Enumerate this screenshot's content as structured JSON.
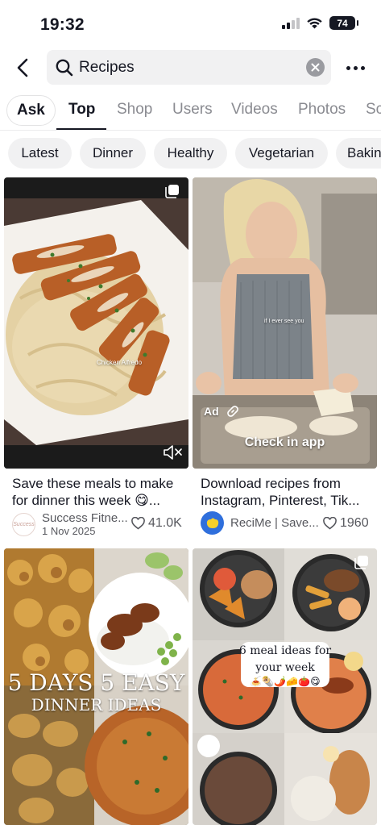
{
  "status_bar": {
    "time": "19:32",
    "battery": "74"
  },
  "search": {
    "query": "Recipes"
  },
  "tabs": [
    {
      "label": "Ask"
    },
    {
      "label": "Top"
    },
    {
      "label": "Shop"
    },
    {
      "label": "Users"
    },
    {
      "label": "Videos"
    },
    {
      "label": "Photos"
    },
    {
      "label": "Sc"
    }
  ],
  "active_tab": "Top",
  "chips": [
    {
      "label": "Latest"
    },
    {
      "label": "Dinner"
    },
    {
      "label": "Healthy"
    },
    {
      "label": "Vegetarian"
    },
    {
      "label": "Bakin"
    }
  ],
  "cards": [
    {
      "overlay": "Chicken Alfredo",
      "title": "Save these meals to make for dinner this week 😋...",
      "author": "Success Fitne...",
      "date": "1 Nov 2025",
      "likes": "41.0K",
      "avatar_text": "Success"
    },
    {
      "overlay": "if I ever see you",
      "ad_label": "Ad",
      "cta": "Check in app",
      "title": "Download recipes from Instagram, Pinterest, Tik...",
      "author": "ReciMe | Save...",
      "likes": "1960"
    },
    {
      "overlay_line1": "5 DAYS 5 EASY",
      "overlay_line2": "DINNER IDEAS"
    },
    {
      "overlay_line1": "6 meal ideas for",
      "overlay_line2": "your week",
      "overlay_emoji": "🍝🌯🌶️🧀🍅😋"
    }
  ],
  "colors": {
    "accent": "#161823",
    "muted": "#8a8b91",
    "chip_bg": "#f1f1f2",
    "recime_blue": "#2f6fdc",
    "recime_yellow": "#f6d02c"
  }
}
